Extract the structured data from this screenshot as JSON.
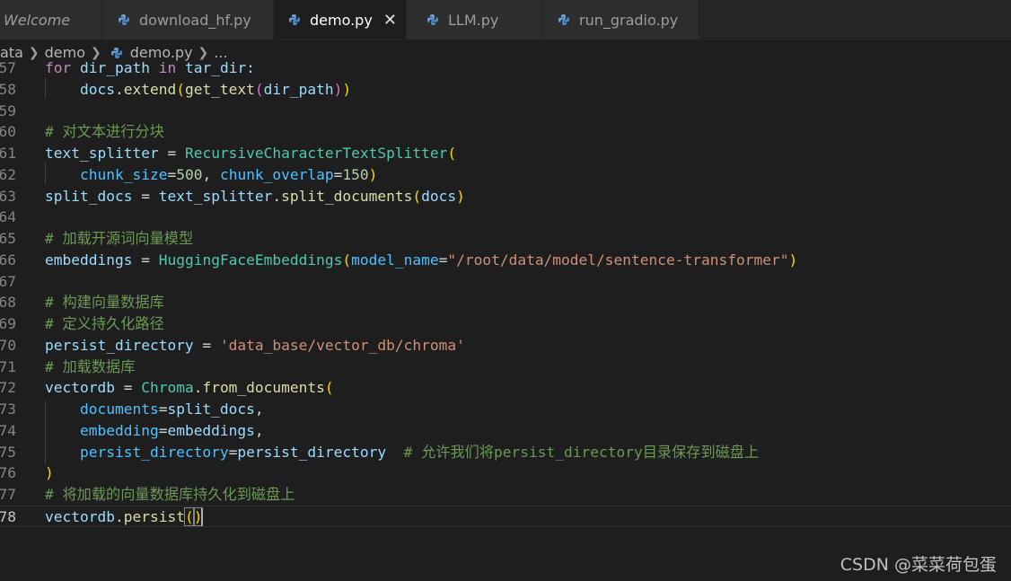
{
  "tabs": [
    {
      "label": "Welcome",
      "icon": "vscode-icon"
    },
    {
      "label": "download_hf.py",
      "icon": "python-icon"
    },
    {
      "label": "demo.py",
      "icon": "python-icon",
      "close": "✕"
    },
    {
      "label": "LLM.py",
      "icon": "python-icon"
    },
    {
      "label": "run_gradio.py",
      "icon": "python-icon"
    }
  ],
  "breadcrumb": {
    "seg1": "ata",
    "seg2": "demo",
    "file": "demo.py",
    "more": "..."
  },
  "line_numbers": [
    "57",
    "58",
    "59",
    "60",
    "61",
    "62",
    "63",
    "64",
    "65",
    "66",
    "67",
    "68",
    "69",
    "70",
    "71",
    "72",
    "73",
    "74",
    "75",
    "76",
    "77",
    "78"
  ],
  "code": {
    "l57": [
      "for",
      " dir_path ",
      "in",
      " tar_dir:"
    ],
    "l58": [
      "docs",
      ".extend",
      "(",
      "get_text",
      "(",
      "dir_path",
      ")",
      ")"
    ],
    "l60": "# 对文本进行分块",
    "l61": [
      "text_splitter",
      " = ",
      "RecursiveCharacterTextSplitter",
      "("
    ],
    "l62": [
      "chunk_size",
      "=",
      "500",
      ", ",
      "chunk_overlap",
      "=",
      "150",
      ")"
    ],
    "l63": [
      "split_docs",
      " = ",
      "text_splitter",
      ".split_documents",
      "(",
      "docs",
      ")"
    ],
    "l65": "# 加载开源词向量模型",
    "l66": [
      "embeddings",
      " = ",
      "HuggingFaceEmbeddings",
      "(",
      "model_name",
      "=",
      "\"/root/data/model/sentence-transformer\"",
      ")"
    ],
    "l68": "# 构建向量数据库",
    "l69": "# 定义持久化路径",
    "l70": [
      "persist_directory",
      " = ",
      "'data_base/vector_db/chroma'"
    ],
    "l71": "# 加载数据库",
    "l72": [
      "vectordb",
      " = ",
      "Chroma",
      ".from_documents",
      "("
    ],
    "l73": [
      "documents",
      "=",
      "split_docs",
      ","
    ],
    "l74": [
      "embedding",
      "=",
      "embeddings",
      ","
    ],
    "l75": [
      "persist_directory",
      "=",
      "persist_directory",
      "  ",
      "# 允许我们将persist_directory目录保存到磁盘上"
    ],
    "l76": ")",
    "l77": "# 将加载的向量数据库持久化到磁盘上",
    "l78": [
      "vectordb",
      ".persist",
      "(",
      ")"
    ]
  },
  "watermark": "CSDN @菜菜荷包蛋",
  "colors": {
    "background": "#1e1e1e",
    "keyword": "#c586c0",
    "variable": "#9cdcfe",
    "function": "#dcdcaa",
    "string": "#ce9178",
    "number": "#b5cea8",
    "comment": "#6a9955",
    "bracket": "#ffd700"
  }
}
